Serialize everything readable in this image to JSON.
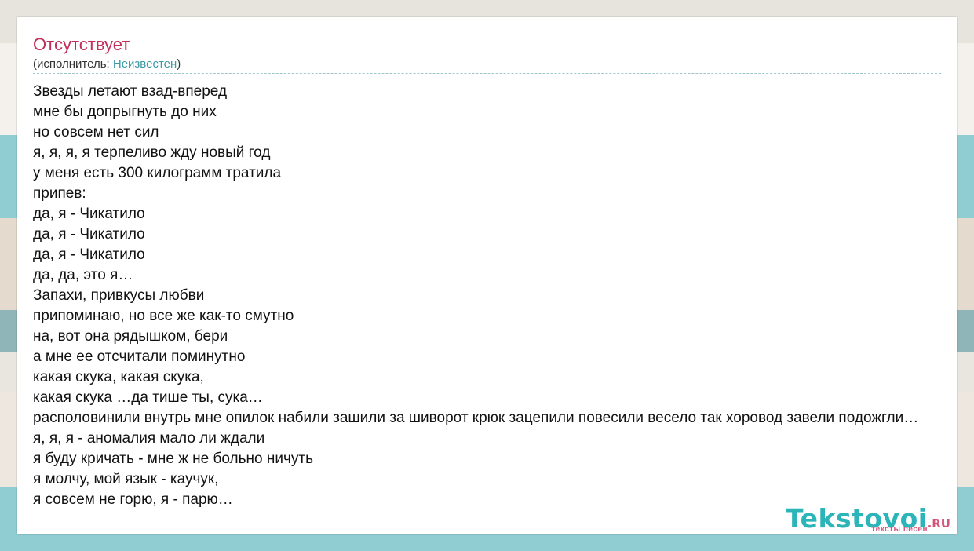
{
  "song": {
    "title": "Отсутствует",
    "artist_prefix": "(исполнитель: ",
    "artist": "Неизвестен",
    "artist_suffix": ")"
  },
  "lyrics": [
    "Звезды летают взад-вперед",
    "мне бы допрыгнуть до них",
    "но совсем нет сил",
    "я, я, я, я терпеливо жду новый год",
    "у меня есть 300 килограмм тратила",
    "припев:",
    "да, я - Чикатило",
    "да, я - Чикатило",
    "да, я - Чикатило",
    "да, да, это я…",
    "Запахи, привкусы любви",
    "припоминаю, но все же как-то смутно",
    "на, вот она рядышком, бери",
    "а мне ее отсчитали поминутно",
    "какая скука, какая скука,",
    "какая скука …да тише ты, сука…",
    "располовинили внутрь мне опилок набили зашили за шиворот крюк зацепили повесили весело так хоровод завели подожгли…",
    "я, я, я - аномалия мало ли ждали",
    "я буду кричать - мне ж не больно ничуть",
    "я молчу, мой язык - каучук,",
    "я совсем не горю, я - парю…"
  ],
  "logo": {
    "name": "Tekstovoi",
    "tld": ".RU",
    "tagline": "тексты песен"
  },
  "colors": {
    "title": "#c0305a",
    "link": "#3a9aa5",
    "logo_main": "#2bb5b9",
    "logo_accent": "#d2557a"
  }
}
